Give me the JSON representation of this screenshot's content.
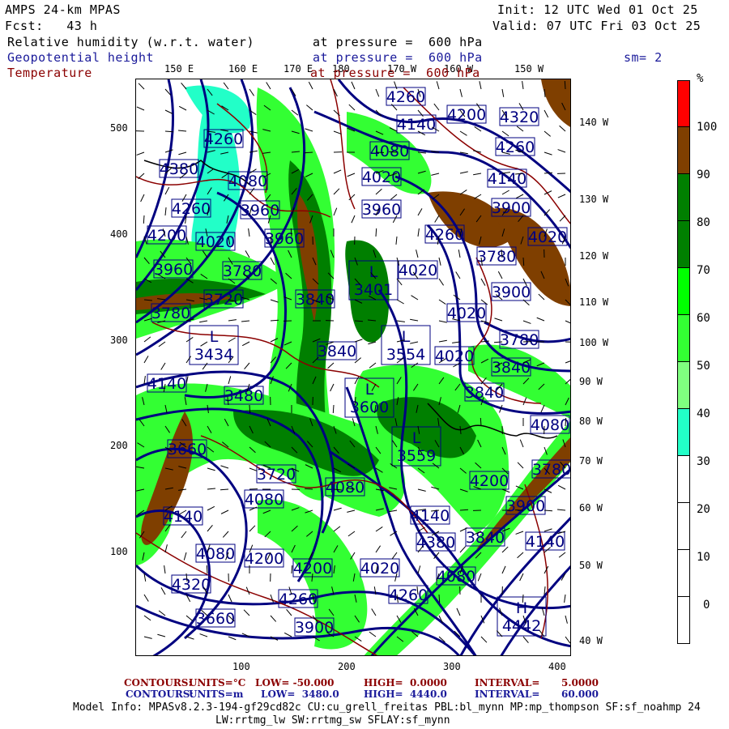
{
  "header": {
    "model": "AMPS 24-km MPAS",
    "fcst": "Fcst:   43 h",
    "init": "Init: 12 UTC Wed 01 Oct 25",
    "valid": "Valid: 07 UTC Fri 03 Oct 25",
    "fields": [
      {
        "name": "Relative humidity (w.r.t. water)",
        "level": "at pressure =  600 hPa"
      },
      {
        "name": "Geopotential height",
        "level": "at pressure =  600 hPa",
        "extra": "sm= 2"
      },
      {
        "name": "Temperature",
        "level": "at pressure =  600 hPa"
      }
    ]
  },
  "lon_top": [
    "150 E",
    "160 E",
    "170 E",
    "180",
    "170 W",
    "160 W",
    "150 W"
  ],
  "lon_right": [
    "140 W",
    "130 W",
    "120 W",
    "110 W",
    "100 W",
    "90 W",
    "80 W",
    "70 W",
    "60 W",
    "50 W",
    "40 W"
  ],
  "y_axis": [
    "500",
    "400",
    "300",
    "200",
    "100"
  ],
  "x_axis": [
    "100",
    "200",
    "300",
    "400"
  ],
  "colorbar": {
    "unit": "%",
    "labels": [
      "100",
      "90",
      "80",
      "70",
      "60",
      "50",
      "40",
      "30",
      "20",
      "10",
      "0"
    ],
    "colors": [
      "#ff0000",
      "#7f3f00",
      "#007f00",
      "#007f00",
      "#00ff00",
      "#33ff33",
      "#7fff7f",
      "#22ffc8",
      "#ffffff",
      "#ffffff",
      "#ffffff",
      "#ffffff"
    ]
  },
  "colors": {
    "height": "#000080",
    "temperature": "#8b0000",
    "rh_dark": "#007f00",
    "rh_mid": "#33ff33",
    "rh_light": "#7fff7f",
    "rh_cyan": "#22ffc8",
    "rh_brown": "#7f3f00"
  },
  "height_labels": [
    "4260",
    "4380",
    "4080",
    "4260",
    "3960",
    "4200",
    "4020",
    "3960",
    "3960",
    "3780",
    "3720",
    "3840",
    "3780",
    "4260",
    "4200",
    "4320",
    "4140",
    "4080",
    "4260",
    "4020",
    "4140",
    "3960",
    "3900",
    "4260",
    "4020",
    "3780",
    "4020",
    "3900",
    "4020",
    "3780",
    "3840",
    "4020",
    "3840",
    "4140",
    "3480",
    "3660",
    "3720",
    "4080",
    "4080",
    "4140",
    "4080",
    "4200",
    "4200",
    "4320",
    "4260",
    "3660",
    "3900",
    "3840",
    "4080",
    "4200",
    "3780",
    "3900",
    "4140",
    "4380",
    "3840",
    "4140",
    "4020",
    "4080",
    "4260"
  ],
  "extrema": [
    {
      "type": "L",
      "value": "3434"
    },
    {
      "type": "L",
      "value": "3401"
    },
    {
      "type": "L",
      "value": "3554"
    },
    {
      "type": "L",
      "value": "3600"
    },
    {
      "type": "L",
      "value": "3559"
    },
    {
      "type": "H",
      "value": "4442"
    }
  ],
  "footer": {
    "temp_contours": [
      "CONTOURS:",
      "UNITS=°C",
      "LOW= -50.000",
      "HIGH=  0.0000",
      "INTERVAL=",
      "5.0000"
    ],
    "height_contours": [
      "CONTOURS:",
      "UNITS=m",
      "LOW=  3480.0",
      "HIGH=  4440.0",
      "INTERVAL=",
      "60.000"
    ],
    "model_info": "Model Info: MPASv8.2.3-194-gf29cd82c CU:cu_grell_freitas PBL:bl_mynn MP:mp_thompson SF:sf_noahmp 24",
    "model_info2": "LW:rrtmg_lw SW:rrtmg_sw SFLAY:sf_mynn"
  }
}
